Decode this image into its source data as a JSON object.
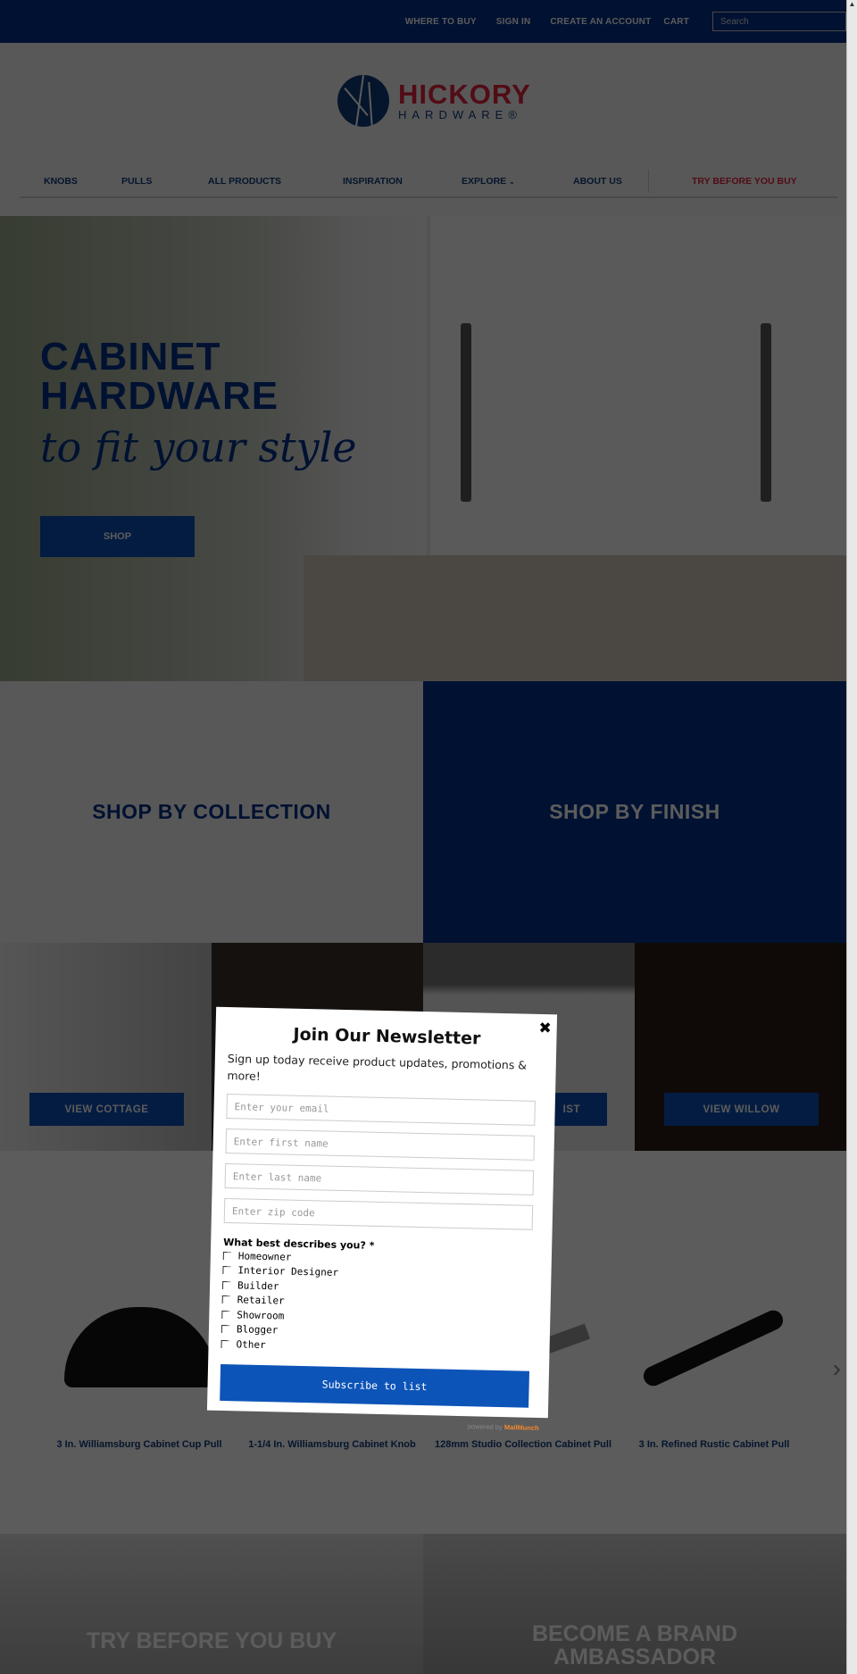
{
  "topbar": {
    "links": [
      "WHERE TO BUY",
      "SIGN IN",
      "CREATE AN ACCOUNT",
      "CART"
    ],
    "search_placeholder": "Search"
  },
  "logo": {
    "line1": "HICKORY",
    "line2": "HARDWARE®"
  },
  "nav": {
    "items": [
      "KNOBS",
      "PULLS",
      "ALL PRODUCTS",
      "INSPIRATION",
      "EXPLORE",
      "ABOUT US"
    ],
    "highlight": "TRY BEFORE YOU BUY",
    "explore_icon": "chevron-down-icon"
  },
  "hero": {
    "title_line1": "CABINET",
    "title_line2": "HARDWARE",
    "script": "to fit your style",
    "button": "SHOP"
  },
  "shop_by": {
    "collection": "SHOP BY COLLECTION",
    "finish": "SHOP BY FINISH"
  },
  "tiles": [
    {
      "button": "VIEW COTTAGE"
    },
    {
      "button": ""
    },
    {
      "button": "IST"
    },
    {
      "button": "VIEW WILLOW"
    }
  ],
  "products": [
    "3 In. Williamsburg Cabinet Cup Pull",
    "1-1/4 In. Williamsburg Cabinet Knob",
    "128mm Studio Collection Cabinet Pull",
    "3 In. Refined Rustic Cabinet Pull"
  ],
  "bottom": {
    "left": "TRY BEFORE YOU BUY",
    "right": "BECOME A BRAND AMBASSADOR"
  },
  "modal": {
    "title": "Join Our Newsletter",
    "subtitle": "Sign up today receive product updates, promotions & more!",
    "placeholders": {
      "email": "Enter your email",
      "first": "Enter first name",
      "last": "Enter last name",
      "zip": "Enter zip code"
    },
    "question": "What best describes you? *",
    "options": [
      "Homeowner",
      "Interior Designer",
      "Builder",
      "Retailer",
      "Showroom",
      "Blogger",
      "Other"
    ],
    "submit": "Subscribe to list",
    "powered_prefix": "powered by",
    "powered_brand": "MailMunch"
  },
  "colors": {
    "brand_blue": "#003087",
    "accent_red": "#c8102e",
    "button_blue": "#0d54b8"
  }
}
